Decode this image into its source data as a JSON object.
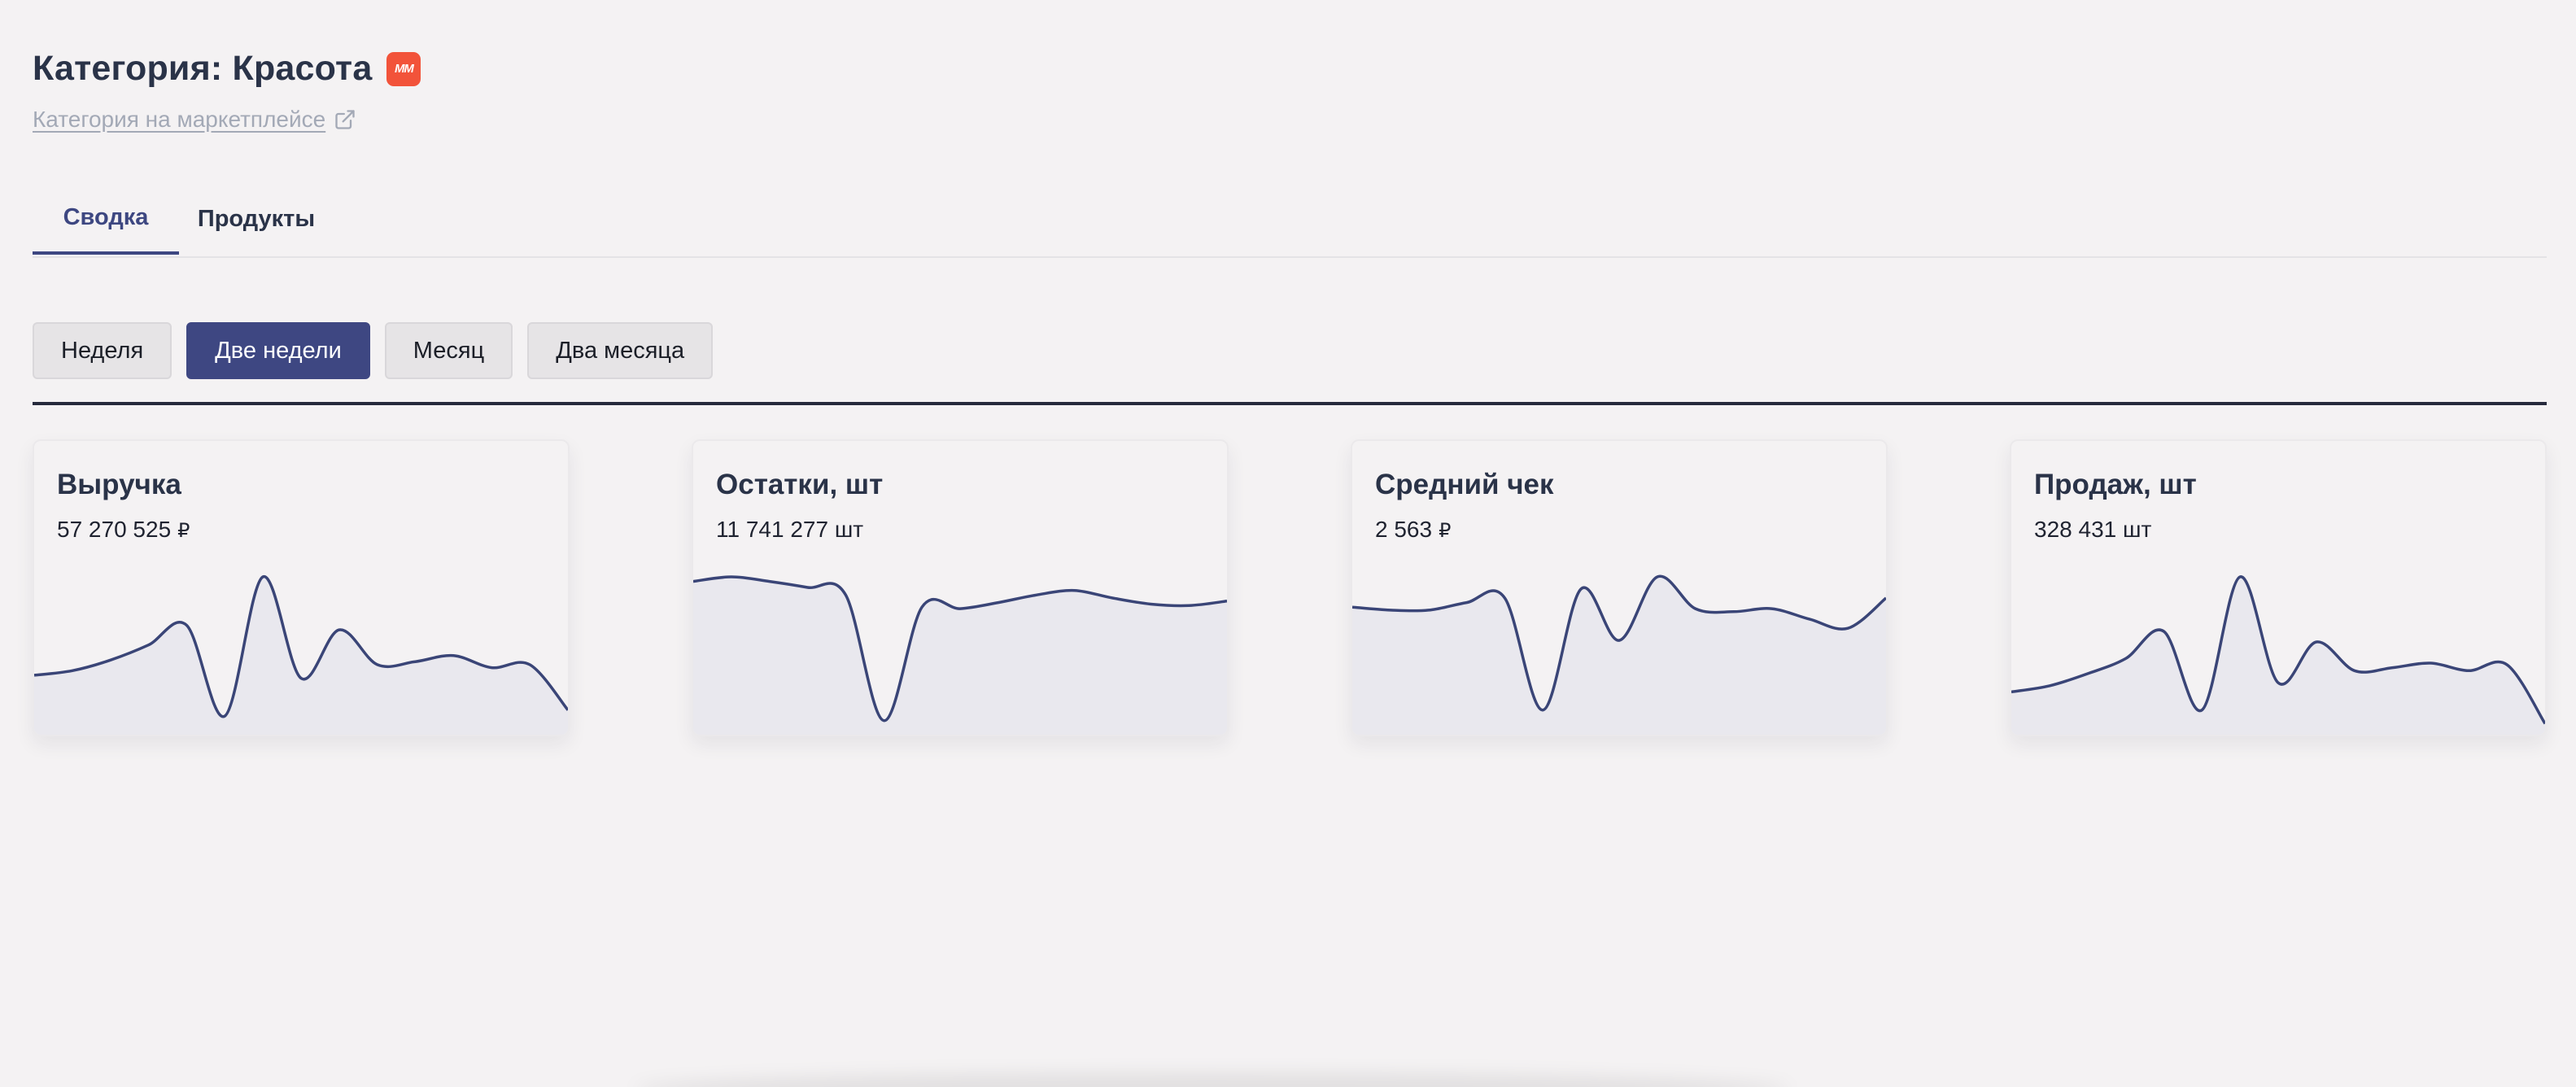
{
  "header": {
    "title": "Категория: Красота",
    "marketplace_badge": "MM",
    "marketplace_link": "Категория на маркетплейсе",
    "badge_color": "#f2533a"
  },
  "tabs": [
    {
      "label": "Сводка",
      "active": true
    },
    {
      "label": "Продукты",
      "active": false
    }
  ],
  "periods": [
    {
      "label": "Неделя",
      "active": false
    },
    {
      "label": "Две недели",
      "active": true
    },
    {
      "label": "Месяц",
      "active": false
    },
    {
      "label": "Два месяца",
      "active": false
    }
  ],
  "colors": {
    "accent": "#3e4782",
    "background": "#f4f2f3",
    "sparkline": "#3a4577",
    "sparkline_fill": "#e9e8ee"
  },
  "cards": [
    {
      "title": "Выручка",
      "value": "57 270 525",
      "unit": "₽"
    },
    {
      "title": "Остатки, шт",
      "value": "11 741 277 шт",
      "unit": ""
    },
    {
      "title": "Средний чек",
      "value": "2 563",
      "unit": "₽"
    },
    {
      "title": "Продаж, шт",
      "value": "328 431 шт",
      "unit": ""
    }
  ],
  "chart_data": [
    {
      "type": "area",
      "title": "Выручка",
      "values": [
        0.35,
        0.38,
        0.45,
        0.55,
        0.68,
        0.08,
        1.0,
        0.33,
        0.65,
        0.42,
        0.44,
        0.48,
        0.4,
        0.42,
        0.12
      ]
    },
    {
      "type": "area",
      "title": "Остатки, шт",
      "values": [
        0.97,
        1.0,
        0.97,
        0.93,
        0.88,
        0.05,
        0.8,
        0.79,
        0.83,
        0.88,
        0.91,
        0.86,
        0.82,
        0.81,
        0.84
      ]
    },
    {
      "type": "area",
      "title": "Средний чек",
      "values": [
        0.8,
        0.78,
        0.78,
        0.83,
        0.86,
        0.12,
        0.92,
        0.58,
        1.0,
        0.79,
        0.77,
        0.79,
        0.72,
        0.66,
        0.86
      ]
    },
    {
      "type": "area",
      "title": "Продаж, шт",
      "values": [
        0.24,
        0.28,
        0.36,
        0.46,
        0.64,
        0.12,
        1.0,
        0.3,
        0.57,
        0.38,
        0.4,
        0.43,
        0.38,
        0.42,
        0.03
      ]
    }
  ]
}
